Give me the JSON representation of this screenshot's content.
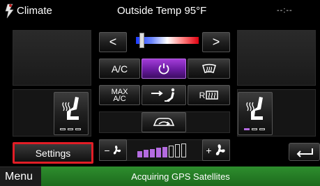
{
  "header": {
    "app_title": "Climate",
    "title": "Outside Temp 95°F",
    "time": "--:--"
  },
  "controls": {
    "temp_left": "<",
    "temp_right": ">",
    "temp_level": 0.1,
    "ac_label": "A/C",
    "max_ac_top": "MAX",
    "max_ac_bottom": "A/C",
    "rear_defrost_prefix": "R",
    "fan_level_filled": 5,
    "fan_level_total": 8,
    "settings_label": "Settings"
  },
  "footer": {
    "menu_label": "Menu",
    "status": "Acquiring GPS Satellites"
  },
  "colors": {
    "power_active": "#8b2cc5",
    "status_bar": "#2e8e2e",
    "settings_border": "#e21d26",
    "seat_heat_active": "#b46be0"
  },
  "icons": [
    "logo-icon",
    "power-icon",
    "front-defrost-icon",
    "airflow-feet-face-icon",
    "recirculation-icon",
    "heated-seat-icon",
    "fan-icon",
    "back-arrow-icon"
  ]
}
